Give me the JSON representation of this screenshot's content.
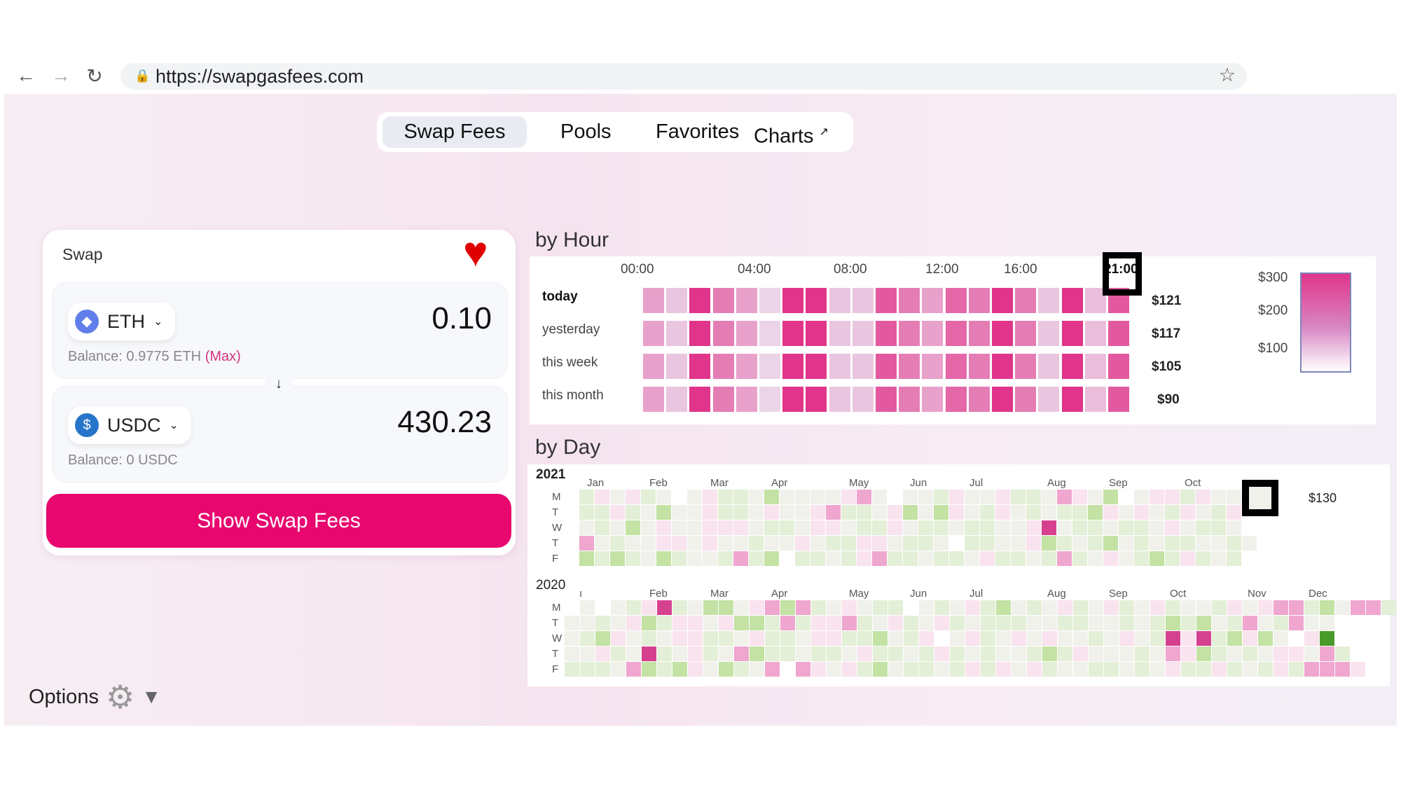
{
  "browser": {
    "url": "https://swapgasfees.com",
    "back_icon": "←",
    "forward_icon": "→",
    "reload_icon": "↻",
    "lock_icon": "🔒",
    "star_icon": "☆"
  },
  "nav": {
    "tabs": [
      {
        "label": "Swap Fees",
        "active": true
      },
      {
        "label": "Pools"
      },
      {
        "label": "Favorites"
      },
      {
        "label": "Charts",
        "external_icon": "↗"
      }
    ]
  },
  "swap": {
    "title": "Swap",
    "favorite_icon": "♥",
    "favorite_color": "#e00000",
    "from": {
      "token": "ETH",
      "amount": "0.10",
      "balance": "Balance: 0.9775 ETH",
      "max_label": "(Max)"
    },
    "to": {
      "token": "USDC",
      "amount": "430.23",
      "balance": "Balance: 0 USDC"
    },
    "direction_icon": "↓",
    "button_label": "Show Swap Fees",
    "accent": "#e8066f"
  },
  "options": {
    "label": "Options",
    "gear_icon": "⚙",
    "caret_icon": "▼"
  },
  "by_hour": {
    "title": "by Hour",
    "hour_labels": [
      "00:00",
      "04:00",
      "08:00",
      "12:00",
      "16:00",
      "21:00"
    ],
    "rows": [
      {
        "label": "today",
        "total": "$121",
        "values": [
          150,
          100,
          300,
          200,
          150,
          80,
          300,
          300,
          100,
          100,
          250,
          200,
          150,
          230,
          200,
          300,
          200,
          100,
          300,
          110,
          250
        ]
      },
      {
        "label": "yesterday",
        "total": "$117",
        "values": [
          150,
          100,
          300,
          200,
          150,
          80,
          300,
          300,
          100,
          100,
          250,
          200,
          150,
          230,
          200,
          300,
          200,
          100,
          300,
          110,
          250
        ]
      },
      {
        "label": "this week",
        "total": "$105",
        "values": [
          150,
          100,
          300,
          200,
          150,
          80,
          300,
          300,
          100,
          100,
          250,
          200,
          150,
          230,
          200,
          300,
          200,
          100,
          300,
          110,
          250
        ]
      },
      {
        "label": "this month",
        "total": "$90",
        "values": [
          150,
          100,
          300,
          200,
          150,
          80,
          300,
          300,
          100,
          100,
          250,
          200,
          150,
          230,
          200,
          300,
          200,
          100,
          300,
          110,
          250
        ]
      }
    ],
    "legend": {
      "labels": [
        "$300",
        "$200",
        "$100"
      ],
      "max_color": "#e0358a",
      "min_color": "#ffffff"
    }
  },
  "by_day": {
    "title": "by Day",
    "selected_value": "$130",
    "weekdays": [
      "M",
      "T",
      "W",
      "T",
      "F"
    ],
    "level_colors": {
      ".": "#f1f1ec",
      "g": "#e3efd6",
      "G": "#c3e2a4",
      "D": "#4a9a2a",
      "p": "#f8e3ee",
      "P": "#efa6cf",
      "M": "#d6418f",
      " ": "#ffffff"
    },
    "years": [
      {
        "year": "2021",
        "months": [
          "Jan",
          "Feb",
          "Mar",
          "Apr",
          "May",
          "Jun",
          "Jul",
          "Aug",
          "Sep",
          "Oct"
        ],
        "rows": [
          "gp.pg. .pgg.G....pP. ..gp..pgg.Pp.G .ppgp...",
          "ggpg.G..pgg.p..pPgg.pG.Gp.gp.g.ggGp.p.gp.gp",
          ".g.G.p..ppp.gg.pp.ggp.gg.gg..pM.gg.gg.p.gg.",
          "P.g..pp.p..g..p.ggpp.gg. gg..pGg.gG.g.gg..g.",
          "GgGg.Gg..gPgG gg.gpPgg.gg.pgg.gPg.p.gGgpg.g"
        ]
      },
      {
        "year": "2020",
        "months": [
          "ı",
          "Feb",
          "Mar",
          "Apr",
          "May",
          "Jun",
          "Jul",
          "Aug",
          "Sep",
          "Oct",
          "Nov",
          "Dec"
        ],
        "rows": [
          " . .gpMg.GG.pPGPg.p.gg .g.pgG.g.pg.pg.pg..gp.pPPgG.PPg",
          "..g.pGgpp.pGGgPgppPg.pg.pg.ggg..gg..g.gGgG.gP.gP..",
          ".gGp.g.ppgg.pgg.ppggG.gp .pg.p.p..g.p.gMpMgGpG. pD",
          "..pg.Mg.pg.PGgg.gg.pgg.gpg.g..gGgp...g.PpGg.g.pp.Pg",
          "ggg.PGgGp.Gg.P Pp.pgG.gg.gpgp.pg..gg.g.pggpg.gpgPPPp"
        ]
      }
    ]
  }
}
